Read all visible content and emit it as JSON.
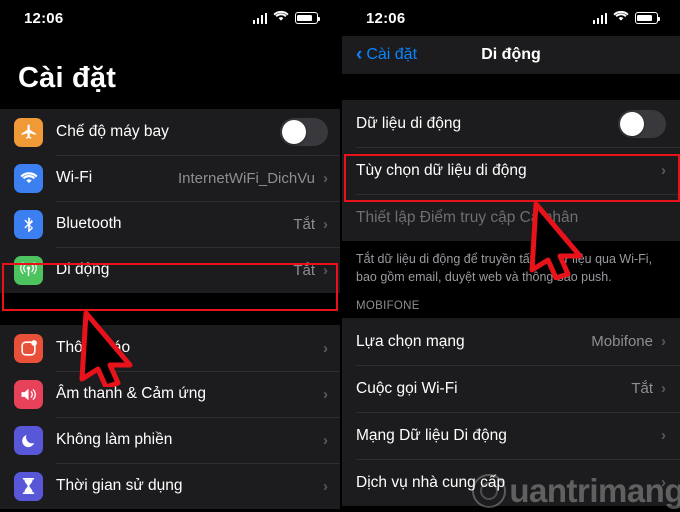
{
  "statusbar": {
    "time": "12:06"
  },
  "left": {
    "title": "Cài đặt",
    "group1": [
      {
        "label": "Chế độ máy bay",
        "icon": "airplane-icon",
        "color": "#f09a37",
        "control": "toggle",
        "toggle_on": false
      },
      {
        "label": "Wi-Fi",
        "icon": "wifi-icon",
        "color": "#3b7ff0",
        "value": "InternetWiFi_DichVu",
        "chevron": "›"
      },
      {
        "label": "Bluetooth",
        "icon": "bluetooth-icon",
        "color": "#3b7ff0",
        "value": "Tắt",
        "chevron": "›"
      },
      {
        "label": "Di động",
        "icon": "cellular-icon",
        "color": "#4cc35e",
        "value": "Tắt",
        "chevron": "›",
        "highlighted": true
      }
    ],
    "group2": [
      {
        "label": "Thông báo",
        "icon": "notifications-icon",
        "color": "#e8503a",
        "chevron": "›"
      },
      {
        "label": "Âm thanh & Cảm ứng",
        "icon": "sound-icon",
        "color": "#e8415a",
        "chevron": "›"
      },
      {
        "label": "Không làm phiền",
        "icon": "moon-icon",
        "color": "#5757d8",
        "chevron": "›"
      },
      {
        "label": "Thời gian sử dụng",
        "icon": "hourglass-icon",
        "color": "#5757d8",
        "chevron": "›"
      }
    ]
  },
  "right": {
    "back_label": "Cài đặt",
    "title": "Di động",
    "rows_top": [
      {
        "label": "Dữ liệu di động",
        "control": "toggle",
        "toggle_on": false
      },
      {
        "label": "Tùy chọn dữ liệu di động",
        "chevron": "›",
        "highlighted": true
      },
      {
        "label": "Thiết lập Điểm truy cập Cá nhân",
        "dim": true
      }
    ],
    "footnote": "Tắt dữ liệu di động để truyền tất cả dữ liệu qua Wi-Fi, bao gồm email, duyệt web và thông báo push.",
    "section_header": "MOBIFONE",
    "rows_carrier": [
      {
        "label": "Lựa chọn mạng",
        "value": "Mobifone",
        "chevron": "›"
      },
      {
        "label": "Cuộc gọi Wi-Fi",
        "value": "Tắt",
        "chevron": "›"
      },
      {
        "label": "Mạng Dữ liệu Di động",
        "chevron": "›"
      },
      {
        "label": "Dịch vụ nhà cung cấp",
        "chevron": "›"
      }
    ]
  },
  "watermark": {
    "text": "uantrimang"
  },
  "annotations": {
    "highlight_color": "#e8121b",
    "cursor_color": "#e8121b"
  }
}
